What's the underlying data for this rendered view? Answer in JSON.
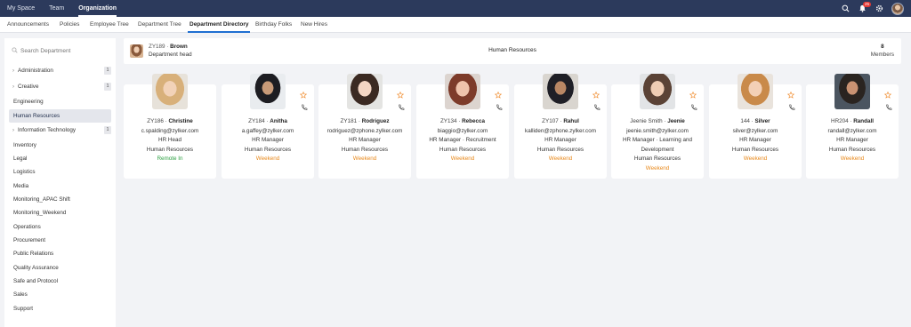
{
  "topnav": {
    "items": [
      "My Space",
      "Team",
      "Organization"
    ],
    "active_index": 2,
    "notification_count": "25",
    "icons": [
      "search-icon",
      "bell-icon",
      "gear-icon",
      "avatar"
    ]
  },
  "subnav": {
    "items": [
      "Announcements",
      "Policies",
      "Employee Tree",
      "Department Tree",
      "Department Directory",
      "Birthday Folks",
      "New Hires"
    ],
    "active_index": 4
  },
  "sidebar": {
    "search_placeholder": "Search Department",
    "departments": [
      {
        "label": "Administration",
        "expandable": true,
        "count": "1"
      },
      {
        "label": "Creative",
        "expandable": true,
        "count": "1"
      },
      {
        "label": "Engineering",
        "expandable": false
      },
      {
        "label": "Human Resources",
        "expandable": false,
        "selected": true
      },
      {
        "label": "Information Technology",
        "expandable": true,
        "count": "1"
      },
      {
        "label": "Inventory",
        "expandable": false
      },
      {
        "label": "Legal",
        "expandable": false
      },
      {
        "label": "Logistics",
        "expandable": false
      },
      {
        "label": "Media",
        "expandable": false
      },
      {
        "label": "Monitoring_APAC Shift",
        "expandable": false
      },
      {
        "label": "Monitoring_Weekend",
        "expandable": false
      },
      {
        "label": "Operations",
        "expandable": false
      },
      {
        "label": "Procurement",
        "expandable": false
      },
      {
        "label": "Public Relations",
        "expandable": false
      },
      {
        "label": "Quality Assurance",
        "expandable": false
      },
      {
        "label": "Safe and Protocol",
        "expandable": false
      },
      {
        "label": "Sales",
        "expandable": false
      },
      {
        "label": "Support",
        "expandable": false
      }
    ]
  },
  "department": {
    "head_id": "ZY189",
    "head_name": "Brown",
    "head_role": "Department head",
    "title": "Human Resources",
    "member_count": "8",
    "member_label": "Members"
  },
  "employees": [
    {
      "id": "ZY186",
      "name": "Christine",
      "email": "c.spalding@zylker.com",
      "designation": "HR Head",
      "department": "Human Resources",
      "status": "Remote In",
      "status_type": "remote",
      "head": false
    },
    {
      "id": "ZY184",
      "name": "Anitha",
      "email": "a.gaffey@zylker.com",
      "designation": "HR Manager",
      "department": "Human Resources",
      "status": "Weekend",
      "status_type": "weekend",
      "head": true
    },
    {
      "id": "ZY181",
      "name": "Rodriguez",
      "email": "rodriguez@zphone.zylker.com",
      "designation": "HR Manager",
      "department": "Human Resources",
      "status": "Weekend",
      "status_type": "weekend",
      "head": true
    },
    {
      "id": "ZY134",
      "name": "Rebecca",
      "email": "biaggio@zylker.com",
      "designation": "HR Manager · Recruitment",
      "department": "Human Resources",
      "status": "Weekend",
      "status_type": "weekend",
      "head": true
    },
    {
      "id": "ZY107",
      "name": "Rahul",
      "email": "kalliden@zphone.zylker.com",
      "designation": "HR Manager",
      "department": "Human Resources",
      "status": "Weekend",
      "status_type": "weekend",
      "head": true
    },
    {
      "id": "Jeenie Smith",
      "name": "Jeenie",
      "email": "jeenie.smith@zylker.com",
      "designation": "HR Manager · Learning and",
      "designation2": "Development",
      "department": "Human Resources",
      "status": "Weekend",
      "status_type": "weekend",
      "head": true
    },
    {
      "id": "144",
      "name": "Silver",
      "email": "silver@zylker.com",
      "designation": "HR Manager",
      "department": "Human Resources",
      "status": "Weekend",
      "status_type": "weekend",
      "head": true
    },
    {
      "id": "HR204",
      "name": "Randall",
      "email": "randall@zylker.com",
      "designation": "HR Manager",
      "department": "Human Resources",
      "status": "Weekend",
      "status_type": "weekend",
      "head": true
    }
  ],
  "colors": {
    "topbar": "#2c3a5c",
    "accent": "#1f6fd1",
    "remote": "#2ea043",
    "weekend": "#e8891c",
    "star": "#f08a2a"
  }
}
